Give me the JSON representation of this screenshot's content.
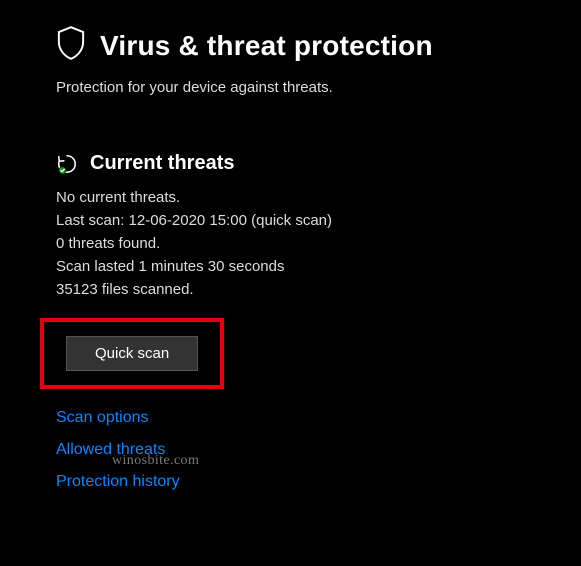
{
  "header": {
    "title": "Virus & threat protection",
    "subtitle": "Protection for your device against threats."
  },
  "currentThreats": {
    "title": "Current threats",
    "status": "No current threats.",
    "lastScan": "Last scan: 12-06-2020 15:00 (quick scan)",
    "threatsFound": "0 threats found.",
    "scanDuration": "Scan lasted 1 minutes 30 seconds",
    "filesScanned": "35123 files scanned.",
    "quickScanLabel": "Quick scan"
  },
  "links": {
    "scanOptions": "Scan options",
    "allowedThreats": "Allowed threats",
    "protectionHistory": "Protection history"
  },
  "watermark": "winosbite.com"
}
